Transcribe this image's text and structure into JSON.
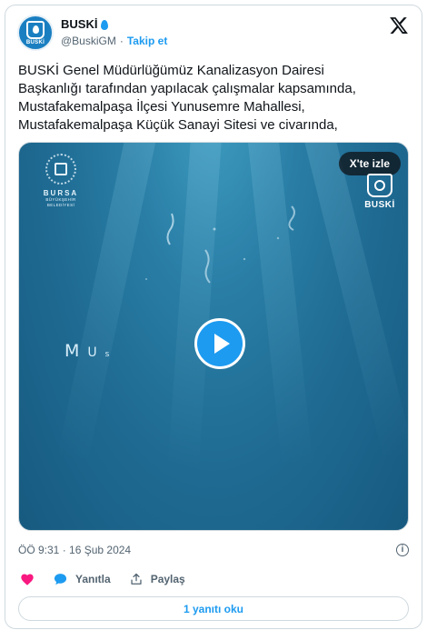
{
  "author": {
    "display_name": "BUSKİ",
    "handle": "@BuskiGM",
    "separator": "·",
    "follow_label": "Takip et",
    "avatar_text": "BUSKİ"
  },
  "tweet": {
    "lines": [
      "BUSKİ Genel Müdürlüğümüz Kanalizasyon Dairesi",
      "Başkanlığı tarafından yapılacak çalışmalar kapsamında,",
      "Mustafakemalpaşa İlçesi  Yunusemre Mahallesi,",
      "Mustafakemalpaşa Küçük Sanayi Sitesi ve civarında,"
    ]
  },
  "media": {
    "watch_label": "X'te izle",
    "left_logo_title": "BURSA",
    "left_logo_sub1": "BÜYÜKŞEHİR",
    "left_logo_sub2": "BELEDİYESİ",
    "right_logo_label": "BUSKİ",
    "caption_chars": [
      "M",
      "U",
      "s"
    ],
    "accent_color": "#1d9bf0"
  },
  "meta": {
    "timestamp": "ÖÖ 9:31 · 16 Şub 2024",
    "info_icon": "i"
  },
  "actions": {
    "reply_label": "Yanıtla",
    "share_label": "Paylaş"
  },
  "replies_button": "1 yanıtı oku",
  "icons": [
    "x-logo-icon",
    "drop-icon",
    "heart-icon",
    "reply-bubble-icon",
    "share-icon",
    "info-icon",
    "play-icon"
  ]
}
